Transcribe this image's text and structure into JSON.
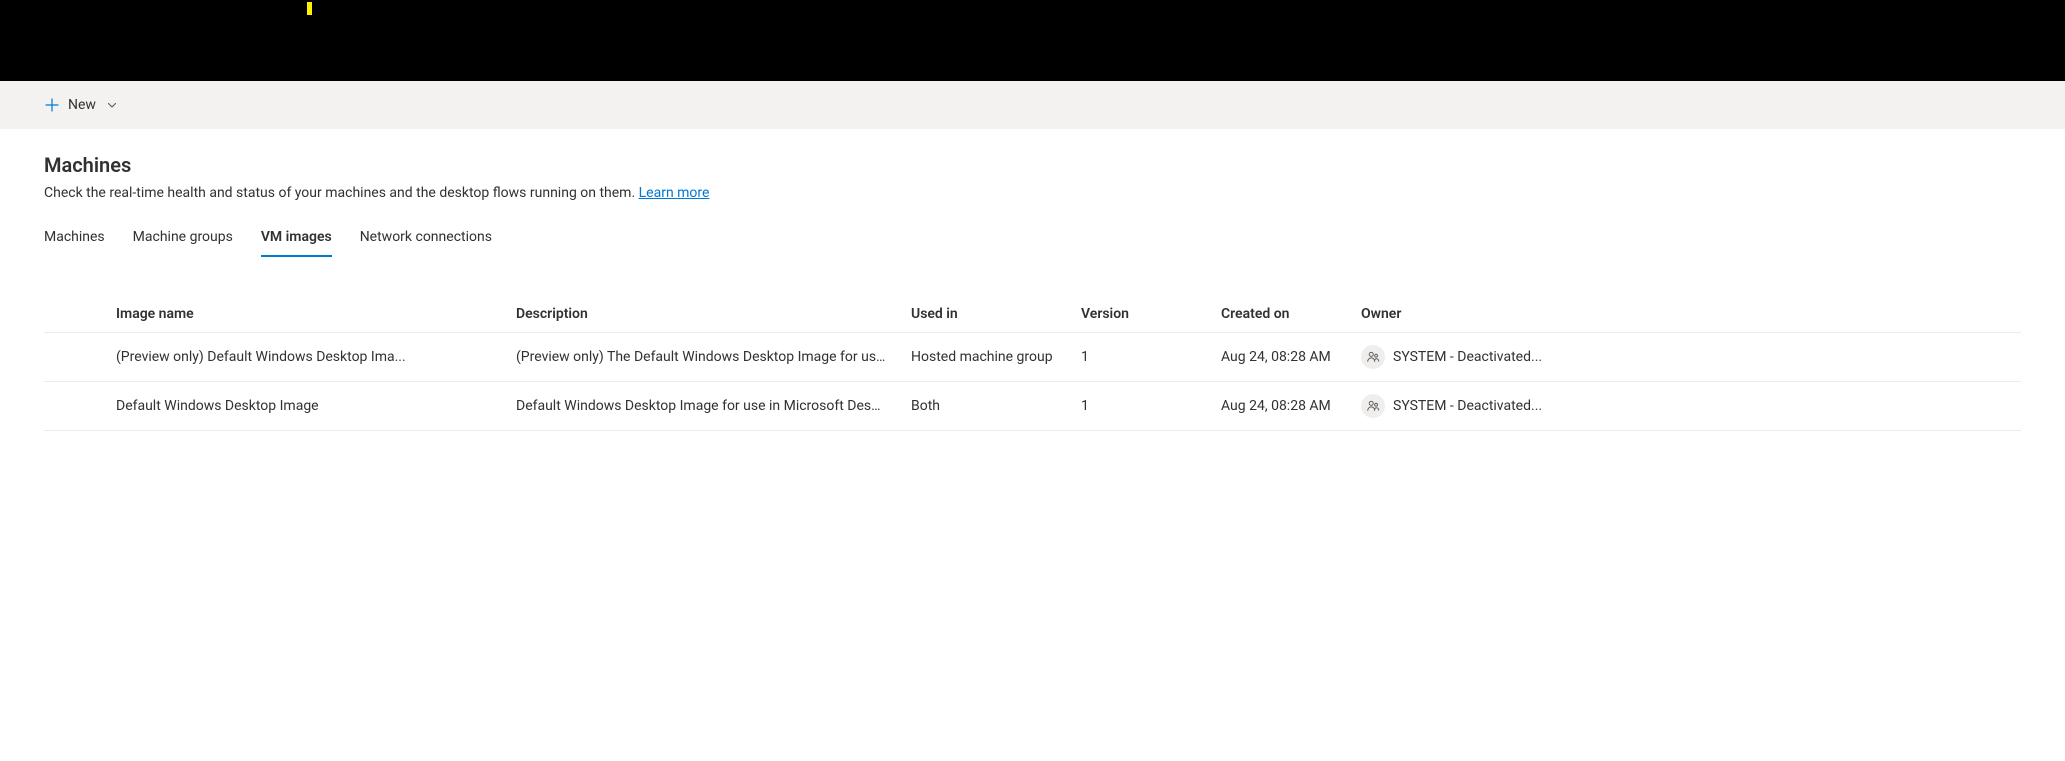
{
  "commandBar": {
    "newLabel": "New"
  },
  "page": {
    "title": "Machines",
    "subtitle": "Check the real-time health and status of your machines and the desktop flows running on them. ",
    "learnMoreLabel": "Learn more"
  },
  "tabs": {
    "machines": "Machines",
    "machineGroups": "Machine groups",
    "vmImages": "VM images",
    "networkConnections": "Network connections"
  },
  "table": {
    "headers": {
      "imageName": "Image name",
      "description": "Description",
      "usedIn": "Used in",
      "version": "Version",
      "createdOn": "Created on",
      "owner": "Owner"
    },
    "rows": [
      {
        "imageName": "(Preview only) Default Windows Desktop Ima...",
        "description": "(Preview only) The Default Windows Desktop Image for use i...",
        "usedIn": "Hosted machine group",
        "version": "1",
        "createdOn": "Aug 24, 08:28 AM",
        "owner": "SYSTEM - Deactivated..."
      },
      {
        "imageName": "Default Windows Desktop Image",
        "description": "Default Windows Desktop Image for use in Microsoft Deskto...",
        "usedIn": "Both",
        "version": "1",
        "createdOn": "Aug 24, 08:28 AM",
        "owner": "SYSTEM - Deactivated..."
      }
    ]
  }
}
